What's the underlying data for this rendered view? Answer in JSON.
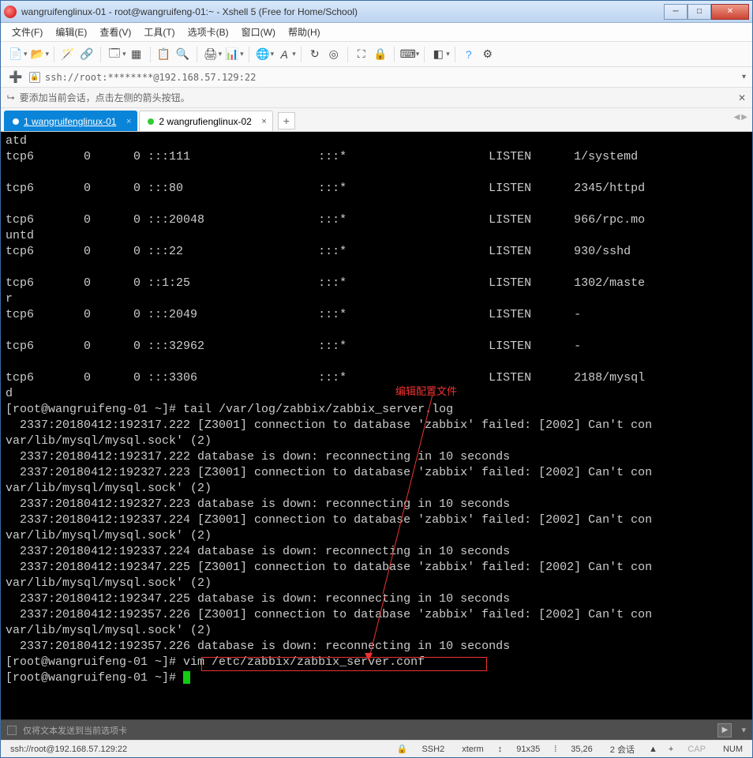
{
  "window": {
    "title": "wangruifenglinux-01 - root@wangruifeng-01:~ - Xshell 5 (Free for Home/School)"
  },
  "menu": [
    "文件(F)",
    "编辑(E)",
    "查看(V)",
    "工具(T)",
    "选项卡(B)",
    "窗口(W)",
    "帮助(H)"
  ],
  "address": {
    "url": "ssh://root:********@192.168.57.129:22"
  },
  "tip": "要添加当前会话，点击左侧的箭头按钮。",
  "tabs": [
    {
      "label": "1 wangruifenglinux-01",
      "active": true
    },
    {
      "label": "2 wangrufienglinux-02",
      "active": false
    }
  ],
  "annot": "编辑配置文件",
  "terminal_text": "atd\ntcp6       0      0 :::111                  :::*                    LISTEN      1/systemd\n\ntcp6       0      0 :::80                   :::*                    LISTEN      2345/httpd\n\ntcp6       0      0 :::20048                :::*                    LISTEN      966/rpc.mo\nuntd\ntcp6       0      0 :::22                   :::*                    LISTEN      930/sshd\n\ntcp6       0      0 ::1:25                  :::*                    LISTEN      1302/maste\nr\ntcp6       0      0 :::2049                 :::*                    LISTEN      -\n\ntcp6       0      0 :::32962                :::*                    LISTEN      -\n\ntcp6       0      0 :::3306                 :::*                    LISTEN      2188/mysql\nd\n[root@wangruifeng-01 ~]# tail /var/log/zabbix/zabbix_server.log\n  2337:20180412:192317.222 [Z3001] connection to database 'zabbix' failed: [2002] Can't con\nvar/lib/mysql/mysql.sock' (2)\n  2337:20180412:192317.222 database is down: reconnecting in 10 seconds\n  2337:20180412:192327.223 [Z3001] connection to database 'zabbix' failed: [2002] Can't con\nvar/lib/mysql/mysql.sock' (2)\n  2337:20180412:192327.223 database is down: reconnecting in 10 seconds\n  2337:20180412:192337.224 [Z3001] connection to database 'zabbix' failed: [2002] Can't con\nvar/lib/mysql/mysql.sock' (2)\n  2337:20180412:192337.224 database is down: reconnecting in 10 seconds\n  2337:20180412:192347.225 [Z3001] connection to database 'zabbix' failed: [2002] Can't con\nvar/lib/mysql/mysql.sock' (2)\n  2337:20180412:192347.225 database is down: reconnecting in 10 seconds\n  2337:20180412:192357.226 [Z3001] connection to database 'zabbix' failed: [2002] Can't con\nvar/lib/mysql/mysql.sock' (2)\n  2337:20180412:192357.226 database is down: reconnecting in 10 seconds\n[root@wangruifeng-01 ~]# vim /etc/zabbix/zabbix_server.conf\n[root@wangruifeng-01 ~]# ",
  "sendbar": "仅将文本发送到当前选项卡",
  "status": {
    "left": "ssh://root@192.168.57.129:22",
    "ssh": "SSH2",
    "term": "xterm",
    "size": "91x35",
    "pos": "35,26",
    "sess": "2 会话",
    "cap": "CAP",
    "num": "NUM"
  }
}
